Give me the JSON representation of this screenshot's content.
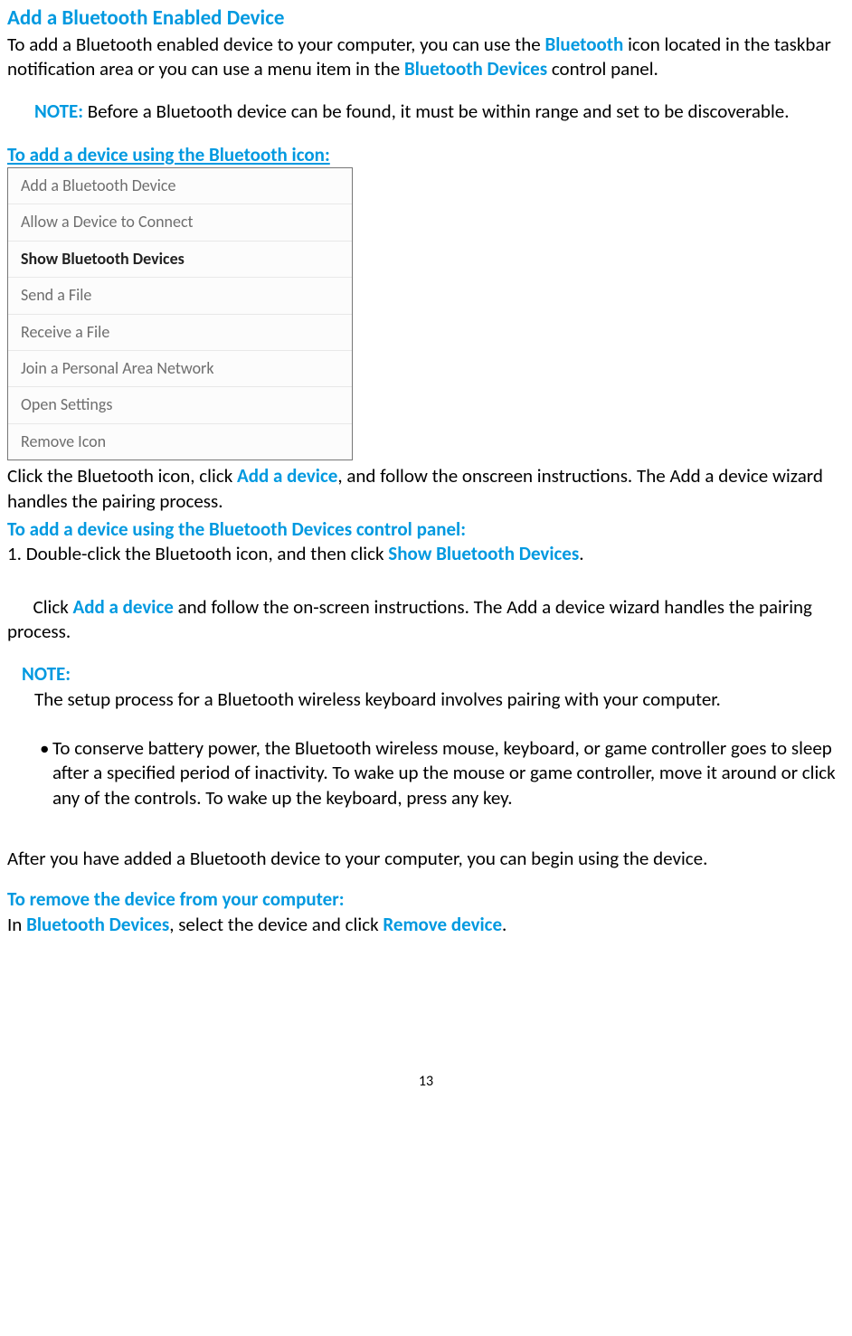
{
  "heading": "Add a Bluetooth Enabled Device",
  "intro": {
    "pre": "To add a Bluetooth enabled device to your computer, you can use the ",
    "bluetooth": "Bluetooth",
    "mid": " icon located in the taskbar notification area or you can use a menu item in the ",
    "devices": "Bluetooth Devices",
    "post": " control panel."
  },
  "note1": {
    "label": "NOTE:",
    "text": " Before a Bluetooth device can be found, it must be within range and set to be discoverable."
  },
  "sub1": "To add a device using the Bluetooth icon:",
  "menu": [
    "Add a Bluetooth Device",
    "Allow a Device to Connect",
    "Show Bluetooth Devices",
    "Send a File",
    "Receive a File",
    "Join a Personal Area Network",
    "Open Settings",
    "Remove Icon"
  ],
  "afterMenu": {
    "pre": "Click the Bluetooth icon, click ",
    "add": "Add a device",
    "post": ", and follow the onscreen instructions. The Add a device wizard handles the pairing process."
  },
  "sub2": "To add a device using the Bluetooth Devices control panel:",
  "step1": {
    "prefix": "1. Double-click the Bluetooth icon, and then click ",
    "show": "Show Bluetooth Devices",
    "dot": "."
  },
  "step2": {
    "pre": "    Click ",
    "add": "Add a device",
    "post": " and follow the on-screen instructions. The Add a device wizard handles the pairing process."
  },
  "note2": {
    "label": "NOTE:",
    "line1": "The setup process for a Bluetooth wireless keyboard involves pairing with your computer.",
    "bullet": "• ",
    "bulletText": "To conserve battery power, the Bluetooth wireless mouse, keyboard, or game controller goes to sleep after a specified period of inactivity. To wake up the mouse or game controller, move it around or click any of the controls. To wake up the keyboard, press any key."
  },
  "afterAdded": "After you have added a Bluetooth device to your computer, you can begin using the device.",
  "sub3": "To remove the device from your computer:",
  "remove": {
    "pre": "In ",
    "devices": "Bluetooth Devices",
    "mid": ", select the device and click ",
    "removedev": "Remove device",
    "post": "."
  },
  "pageNumber": "13"
}
